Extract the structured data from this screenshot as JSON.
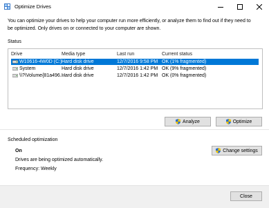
{
  "window": {
    "title": "Optimize Drives"
  },
  "description": "You can optimize your drives to help your computer run more efficiently, or analyze them to find out if they need to\nbe optimized. Only drives on or connected to your computer are shown.",
  "status": {
    "label": "Status",
    "columns": [
      "Drive",
      "Media type",
      "Last run",
      "Current status"
    ],
    "rows": [
      {
        "drive": "W10616-4W0D (C:)",
        "media": "Hard disk drive",
        "last_run": "12/7/2016 9:58 PM",
        "status": "OK (1% fragmented)",
        "selected": true
      },
      {
        "drive": "System",
        "media": "Hard disk drive",
        "last_run": "12/7/2016 1:42 PM",
        "status": "OK (9% fragmented)",
        "selected": false
      },
      {
        "drive": "\\\\?\\Volume{81a496...",
        "media": "Hard disk drive",
        "last_run": "12/7/2016 1:42 PM",
        "status": "OK (0% fragmented)",
        "selected": false
      }
    ]
  },
  "buttons": {
    "analyze": "Analyze",
    "optimize": "Optimize",
    "change_settings": "Change settings",
    "close": "Close"
  },
  "scheduled": {
    "label": "Scheduled optimization",
    "state": "On",
    "info": "Drives are being optimized automatically.",
    "frequency": "Frequency: Weekly"
  },
  "colors": {
    "selection": "#0078d7",
    "button_face": "#e1e1e1",
    "footer": "#f0f0f0"
  },
  "icons": {
    "window": "defrag-icon",
    "drive": "hard-drive-icon",
    "shield": "uac-shield-icon"
  }
}
